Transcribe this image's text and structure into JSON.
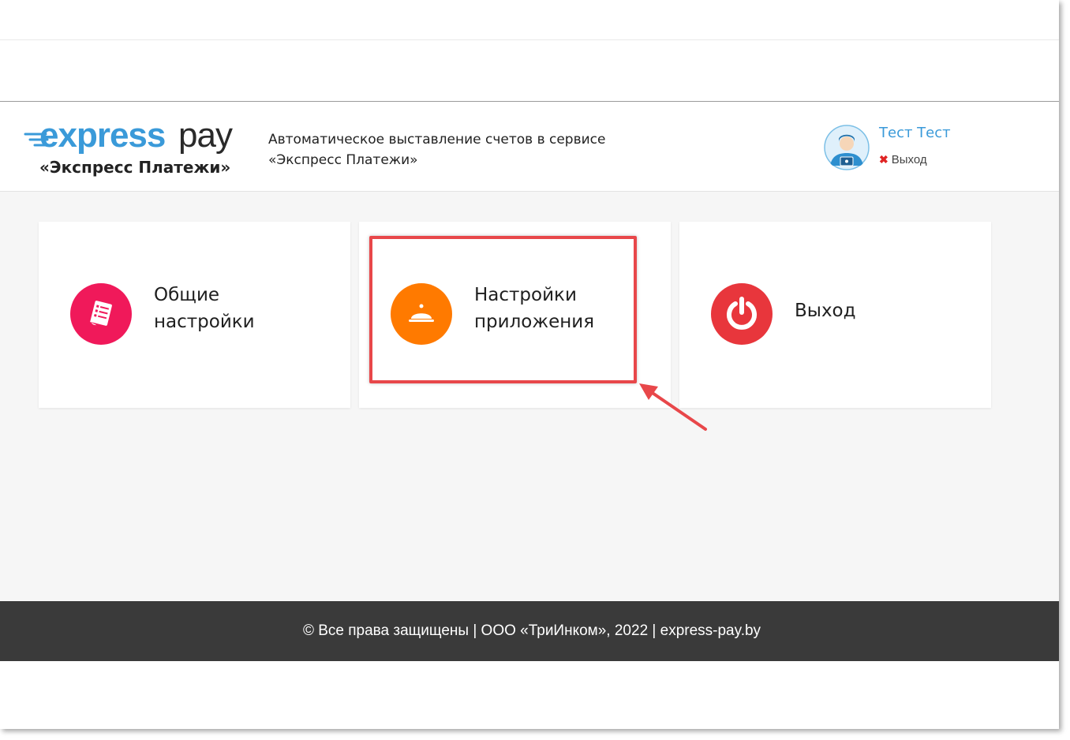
{
  "header": {
    "logo": {
      "brand_express": "express",
      "brand_pay": "pay",
      "subtitle": "«Экспресс Платежи»"
    },
    "tagline_line1": "Автоматическое выставление счетов в сервисе",
    "tagline_line2": "«Экспресс Платежи»",
    "user": {
      "name": "Тест Тест",
      "logout_icon": "close-x-icon",
      "logout_label": "Выход"
    }
  },
  "cards": [
    {
      "icon": "document-list-icon",
      "color": "#f0195a",
      "label_line1": "Общие",
      "label_line2": "настройки"
    },
    {
      "icon": "service-bell-icon",
      "color": "#ff7a00",
      "label_line1": "Настройки",
      "label_line2": "приложения"
    },
    {
      "icon": "power-icon",
      "color": "#e8363c",
      "label_line1": "Выход"
    }
  ],
  "annotation": {
    "color": "#e8474a"
  },
  "footer": {
    "text": "© Все права защищены | ООО «ТриИнком», 2022 | express-pay.by"
  },
  "colors": {
    "brand_blue": "#3a9ad9",
    "footer_bg": "#3a3a3a",
    "content_bg": "#f6f6f6"
  }
}
